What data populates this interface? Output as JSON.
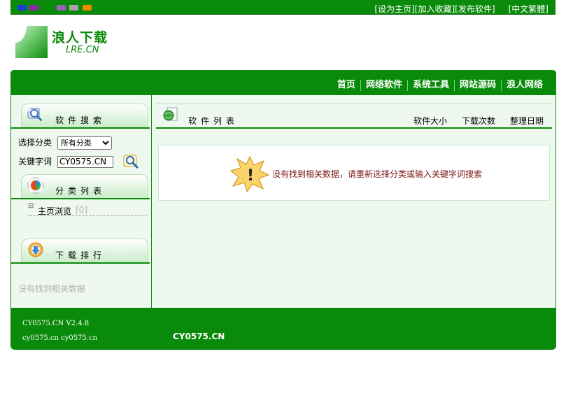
{
  "top_bar": {
    "colors": [
      "#1a3fd0",
      "#8a2aa0",
      "#9a5fb8",
      "#a7a7a7",
      "#f08c00"
    ],
    "links": [
      "[设为主页]",
      "[加入收藏]",
      "[发布软件]",
      "[中文繁體]"
    ]
  },
  "logo": {
    "title": "浪人下载",
    "subtitle": "LRE.CN"
  },
  "nav": {
    "items": [
      "首页",
      "网络软件",
      "系统工具",
      "网站源码",
      "浪人网络"
    ]
  },
  "sidebar": {
    "search": {
      "title": "软件搜索",
      "category_label": "选择分类",
      "category_value": "所有分类",
      "keyword_label": "关键字词",
      "keyword_value": "CY0575.CN",
      "search_icon": "search-icon"
    },
    "categories": {
      "title": "分类列表",
      "items": [
        {
          "label": "主页浏览",
          "count": "[0]"
        }
      ]
    },
    "ranking": {
      "title": "下载排行",
      "empty_text": "没有找到相关数据"
    }
  },
  "content": {
    "title": "软件列表",
    "columns": [
      "软件大小",
      "下载次数",
      "整理日期"
    ],
    "empty_message": "没有找到相关数据，请重新选择分类或输入关键字词搜索"
  },
  "footer": {
    "version": "CY0575.CN V2.4.8",
    "domains": "cy0575.cn cy0575.cn",
    "brand": "CY0575.CN"
  }
}
